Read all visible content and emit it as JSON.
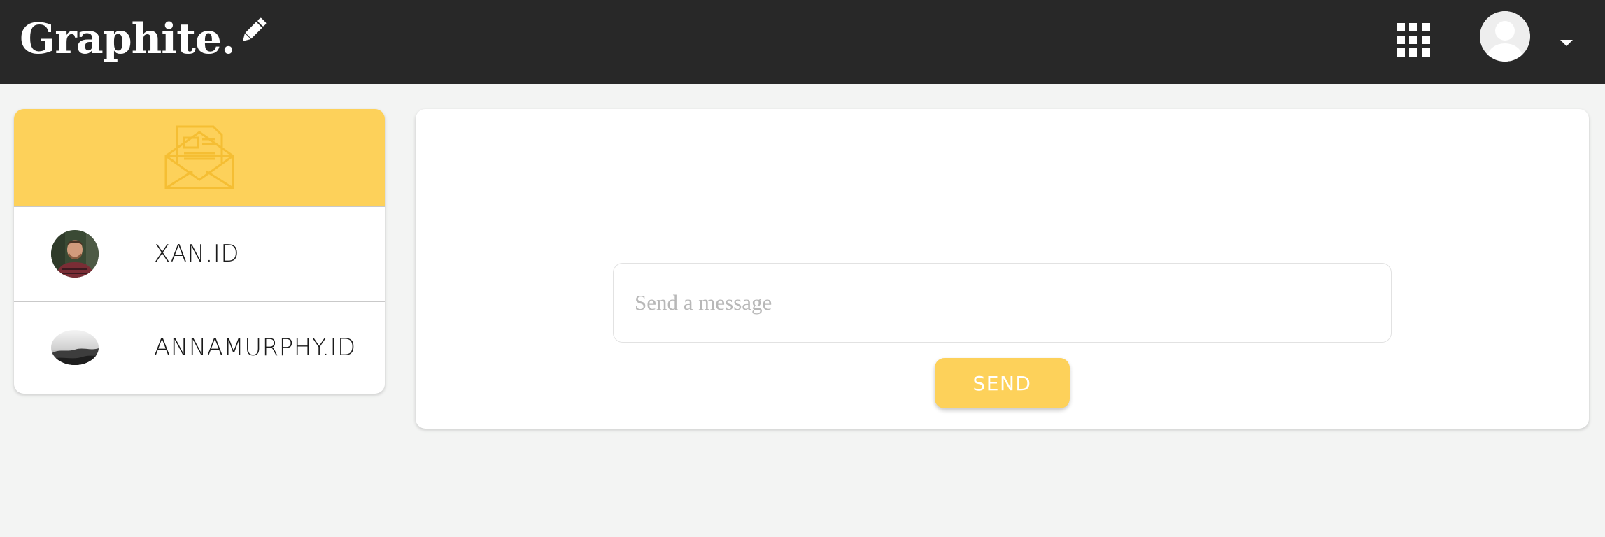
{
  "header": {
    "logo_text": "Graphite.",
    "icons": {
      "logo_pencil": "pencil-icon",
      "apps": "apps-grid-icon",
      "user": "user-avatar-icon",
      "menu": "chevron-down-icon"
    }
  },
  "contacts": {
    "header_icon": "envelope-icon",
    "items": [
      {
        "name": "XAN.ID",
        "avatar": "portrait-avatar"
      },
      {
        "name": "ANNAMURPHY.ID",
        "avatar": "fog-landscape-avatar"
      }
    ]
  },
  "composer": {
    "placeholder": "Send a message",
    "send_label": "SEND"
  },
  "colors": {
    "topbar": "#282828",
    "accent": "#fdd15a",
    "background": "#f3f4f3",
    "card": "#ffffff"
  }
}
